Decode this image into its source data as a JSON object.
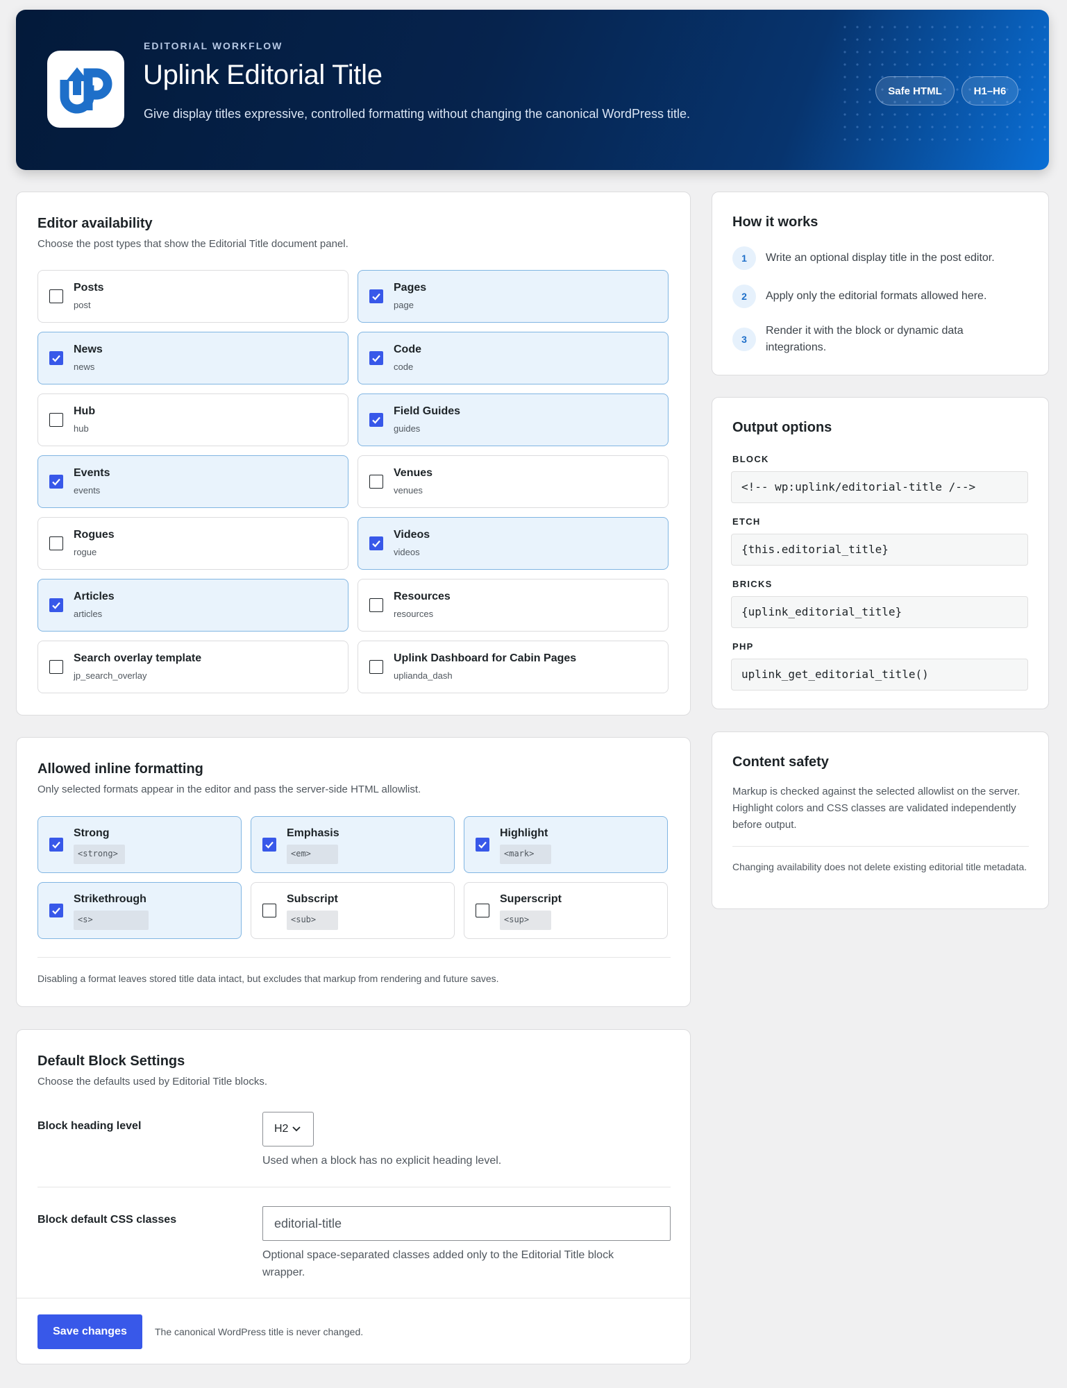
{
  "hero": {
    "logo_icon": "uplink-logo-icon",
    "eyebrow": "EDITORIAL WORKFLOW",
    "title": "Uplink Editorial Title",
    "subtitle": "Give display titles expressive, controlled formatting without changing the canonical WordPress title.",
    "badges": [
      "Safe HTML",
      "H1–H6"
    ]
  },
  "availability": {
    "title": "Editor availability",
    "description": "Choose the post types that show the Editorial Title document panel.",
    "post_types": [
      {
        "label": "Posts",
        "slug": "post",
        "checked": false
      },
      {
        "label": "Pages",
        "slug": "page",
        "checked": true
      },
      {
        "label": "News",
        "slug": "news",
        "checked": true
      },
      {
        "label": "Code",
        "slug": "code",
        "checked": true
      },
      {
        "label": "Hub",
        "slug": "hub",
        "checked": false
      },
      {
        "label": "Field Guides",
        "slug": "guides",
        "checked": true
      },
      {
        "label": "Events",
        "slug": "events",
        "checked": true
      },
      {
        "label": "Venues",
        "slug": "venues",
        "checked": false
      },
      {
        "label": "Rogues",
        "slug": "rogue",
        "checked": false
      },
      {
        "label": "Videos",
        "slug": "videos",
        "checked": true
      },
      {
        "label": "Articles",
        "slug": "articles",
        "checked": true
      },
      {
        "label": "Resources",
        "slug": "resources",
        "checked": false
      },
      {
        "label": "Search overlay template",
        "slug": "jp_search_overlay",
        "checked": false
      },
      {
        "label": "Uplink Dashboard for Cabin Pages",
        "slug": "uplianda_dash",
        "checked": false
      }
    ]
  },
  "formatting": {
    "title": "Allowed inline formatting",
    "description": "Only selected formats appear in the editor and pass the server-side HTML allowlist.",
    "formats": [
      {
        "label": "Strong",
        "tag": "<strong>",
        "checked": true
      },
      {
        "label": "Emphasis",
        "tag": "<em>",
        "checked": true
      },
      {
        "label": "Highlight",
        "tag": "<mark>",
        "checked": true
      },
      {
        "label": "Strikethrough",
        "tag": "<s>",
        "checked": true
      },
      {
        "label": "Subscript",
        "tag": "<sub>",
        "checked": false
      },
      {
        "label": "Superscript",
        "tag": "<sup>",
        "checked": false
      }
    ],
    "note": "Disabling a format leaves stored title data intact, but excludes that markup from rendering and future saves."
  },
  "block_settings": {
    "title": "Default Block Settings",
    "description": "Choose the defaults used by Editorial Title blocks.",
    "heading_label": "Block heading level",
    "heading_value": "H2",
    "heading_help": "Used when a block has no explicit heading level.",
    "css_label": "Block default CSS classes",
    "css_value": "editorial-title",
    "css_help": "Optional space-separated classes added only to the Editorial Title block wrapper.",
    "save_label": "Save changes",
    "save_note": "The canonical WordPress title is never changed."
  },
  "how_it_works": {
    "title": "How it works",
    "steps": [
      {
        "num": "1",
        "text": "Write an optional display title in the post editor."
      },
      {
        "num": "2",
        "text": "Apply only the editorial formats allowed here."
      },
      {
        "num": "3",
        "text": "Render it with the block or dynamic data integrations."
      }
    ]
  },
  "output_options": {
    "title": "Output options",
    "items": [
      {
        "label": "BLOCK",
        "code": "<!-- wp:uplink/editorial-title /-->"
      },
      {
        "label": "ETCH",
        "code": "{this.editorial_title}"
      },
      {
        "label": "BRICKS",
        "code": "{uplink_editorial_title}"
      },
      {
        "label": "PHP",
        "code": "uplink_get_editorial_title()"
      }
    ]
  },
  "content_safety": {
    "title": "Content safety",
    "text": "Markup is checked against the selected allowlist on the server. Highlight colors and CSS classes are validated independently before output.",
    "note": "Changing availability does not delete existing editorial title metadata."
  },
  "colors": {
    "accent": "#3858e9",
    "selected_bg": "#e9f3fc",
    "selected_border": "#80b5e2",
    "hero_dark": "#031a3a",
    "hero_light": "#0a6fd6"
  }
}
